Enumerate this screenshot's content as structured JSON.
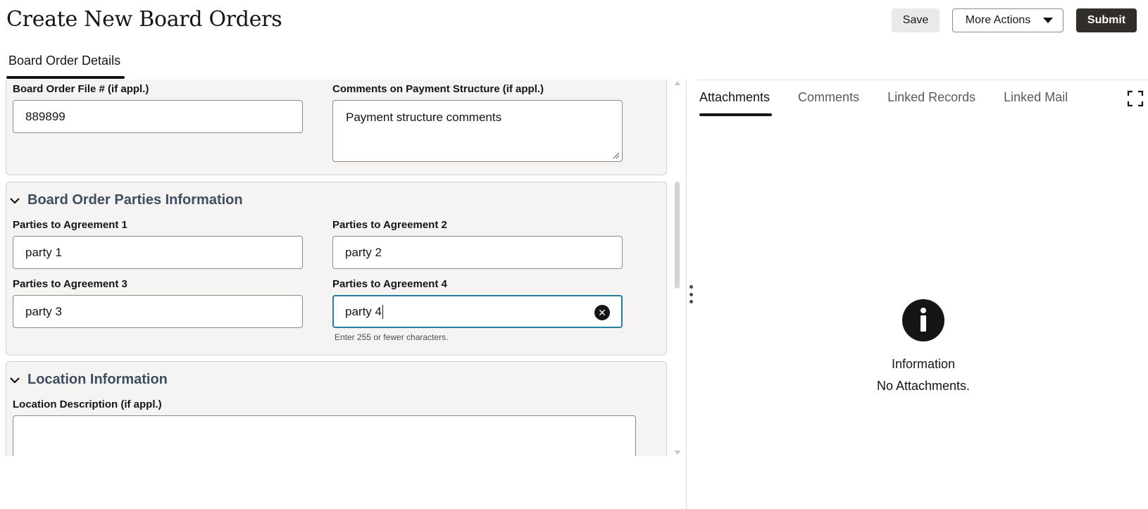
{
  "page": {
    "title": "Create New Board Orders"
  },
  "toolbar": {
    "save_label": "Save",
    "more_actions_label": "More Actions",
    "submit_label": "Submit"
  },
  "main_tabs": [
    {
      "label": "Board Order Details",
      "active": true
    }
  ],
  "sections": {
    "general": {
      "file_number": {
        "label": "Board Order File # (if appl.)",
        "value": "889899"
      },
      "payment_comments": {
        "label": "Comments on Payment Structure (if appl.)",
        "value": "Payment structure comments"
      }
    },
    "parties": {
      "title": "Board Order Parties Information",
      "expanded": true,
      "party1": {
        "label": "Parties to Agreement 1",
        "value": "party 1"
      },
      "party2": {
        "label": "Parties to Agreement 2",
        "value": "party 2"
      },
      "party3": {
        "label": "Parties to Agreement 3",
        "value": "party 3"
      },
      "party4": {
        "label": "Parties to Agreement 4",
        "value": "party 4",
        "helper": "Enter 255 or fewer characters."
      }
    },
    "location": {
      "title": "Location Information",
      "expanded": true,
      "description": {
        "label": "Location Description (if appl.)",
        "value": ""
      }
    }
  },
  "side_panel": {
    "tabs": [
      {
        "label": "Attachments",
        "active": true
      },
      {
        "label": "Comments",
        "active": false
      },
      {
        "label": "Linked Records",
        "active": false
      },
      {
        "label": "Linked Mail",
        "active": false
      }
    ],
    "empty_state": {
      "icon": "info-icon",
      "title": "Information",
      "message": "No Attachments."
    }
  },
  "colors": {
    "primary_button": "#312d2a",
    "section_bg": "#f5f4f2",
    "section_title": "#3e4d61",
    "focus_border": "#227e9e"
  }
}
